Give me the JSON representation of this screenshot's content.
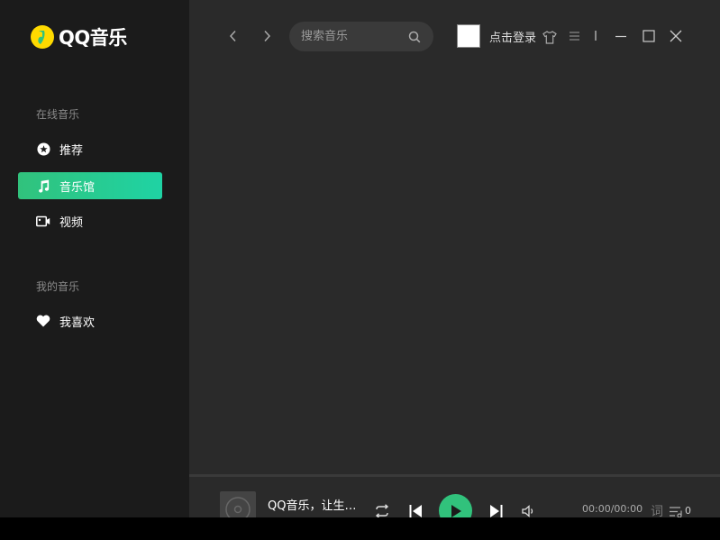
{
  "app": {
    "logo_text": "QQ音乐"
  },
  "sidebar": {
    "online_title": "在线音乐",
    "online_items": [
      {
        "label": "推荐",
        "icon": "star-icon"
      },
      {
        "label": "音乐馆",
        "icon": "music-note-icon",
        "active": true
      },
      {
        "label": "视频",
        "icon": "video-icon"
      }
    ],
    "my_title": "我的音乐",
    "my_items": [
      {
        "label": "我喜欢",
        "icon": "heart-icon"
      }
    ]
  },
  "topbar": {
    "search_placeholder": "搜索音乐",
    "login_label": "点击登录"
  },
  "player": {
    "song_title": "QQ音乐，让生活充满音乐",
    "time": "00:00/00:00",
    "lyric_label": "词",
    "playlist_count": "0"
  },
  "colors": {
    "accent": "#31c27c",
    "sidebar_bg": "#1b1b1b",
    "main_bg": "#2a2a2a"
  }
}
